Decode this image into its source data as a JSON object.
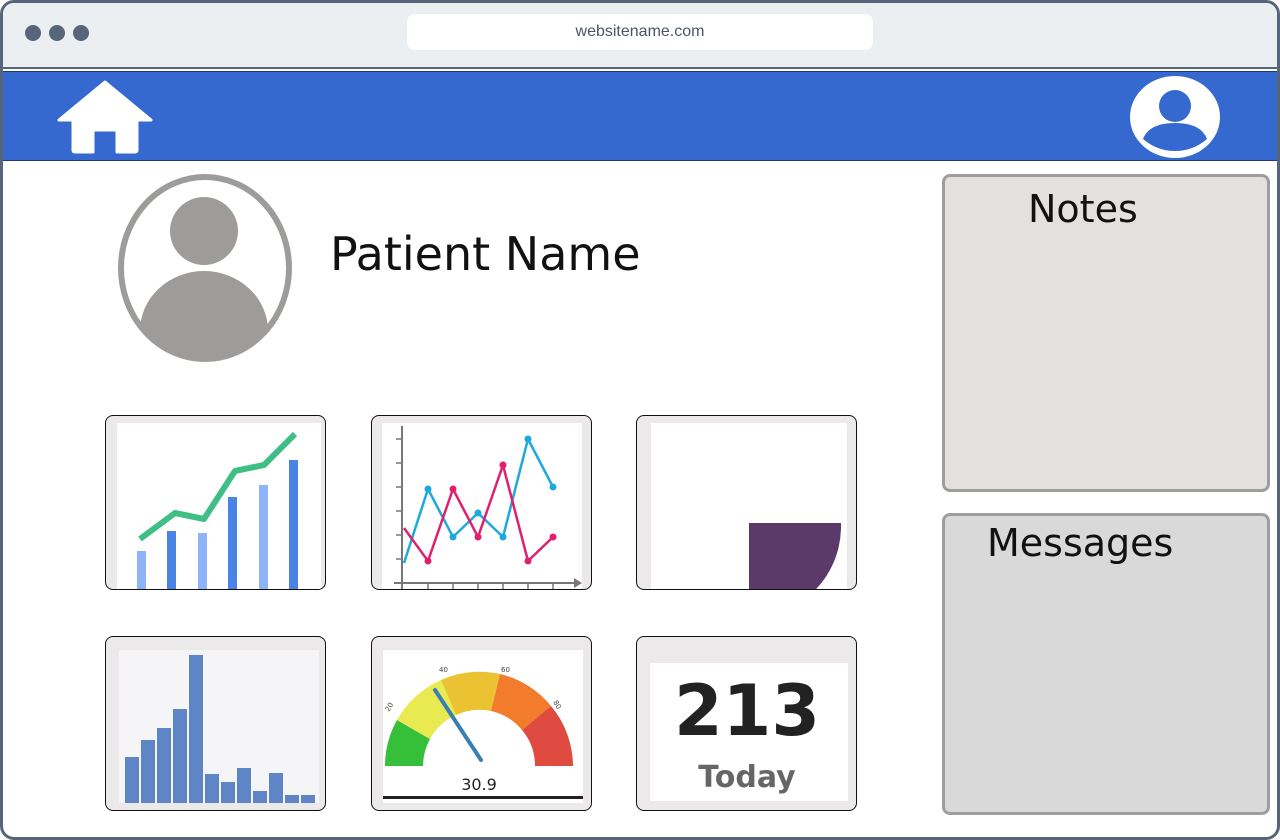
{
  "browser": {
    "url": "websitename.com",
    "window_dots": [
      "dot",
      "dot",
      "dot"
    ]
  },
  "navbar": {
    "home_icon": "home-icon",
    "user_icon": "user-account-icon",
    "color": "#3669cf"
  },
  "patient": {
    "avatar_icon": "patient-avatar-icon",
    "name": "Patient Name"
  },
  "widgets": [
    {
      "icon": "bar-line-chart-thumbnail"
    },
    {
      "icon": "multi-line-chart-thumbnail"
    },
    {
      "icon": "pie-chart-thumbnail"
    },
    {
      "icon": "histogram-thumbnail"
    },
    {
      "icon": "gauge-thumbnail",
      "gauge_value": "30.9",
      "gauge_ticks": [
        "20",
        "40",
        "60",
        "80"
      ]
    },
    {
      "icon": "stat-counter-thumbnail",
      "stat_value": "213",
      "stat_label": "Today"
    }
  ],
  "panels": {
    "notes_title": "Notes",
    "messages_title": "Messages"
  }
}
